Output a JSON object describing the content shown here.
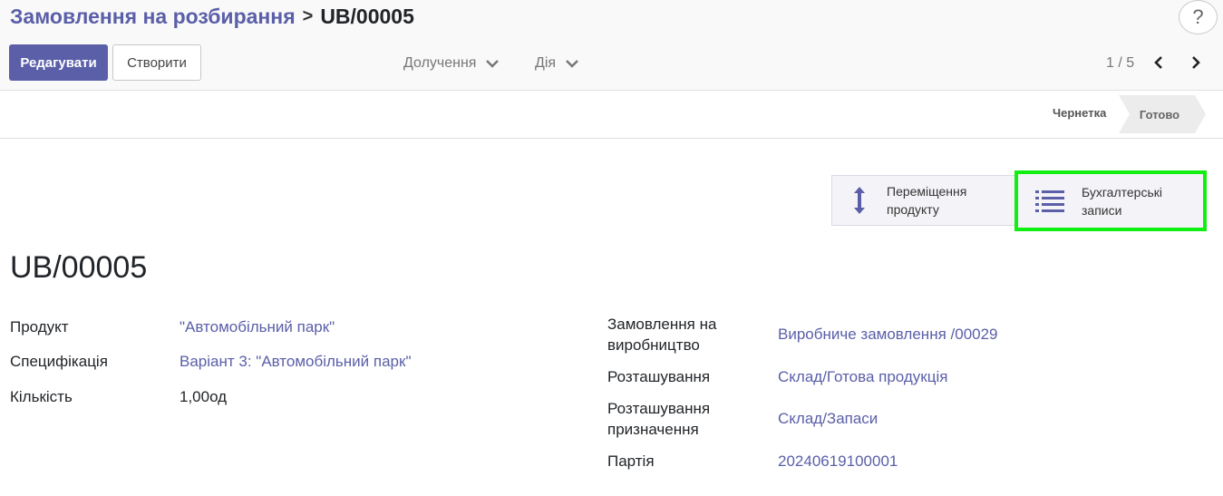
{
  "breadcrumb": {
    "parent": "Замовлення на розбирання",
    "separator": ">",
    "current": "UB/00005"
  },
  "help": {
    "label": "?"
  },
  "toolbar": {
    "edit_label": "Редагувати",
    "create_label": "Створити",
    "attach_label": "Долучення",
    "action_label": "Дія"
  },
  "pager": {
    "value": "1 / 5"
  },
  "statusbar": {
    "stages": [
      "Чернетка",
      "Готово"
    ],
    "current": "Готово"
  },
  "smart_buttons": {
    "moves": {
      "line1": "Переміщення",
      "line2": "продукту",
      "icon": "vertical-arrows-icon"
    },
    "accounting": {
      "line1": "Бухгалтерські",
      "line2": "записи",
      "icon": "list-icon"
    }
  },
  "record": {
    "title": "UB/00005",
    "left_fields": [
      {
        "label": "Продукт",
        "value": "\"Автомобільний парк\""
      },
      {
        "label": "Специфікація",
        "value": "Варіант 3: \"Автомобільний парк\""
      },
      {
        "label": "Кількість",
        "value": "1,00од"
      }
    ],
    "right_fields": [
      {
        "label_line1": "Замовлення на",
        "label_line2": "виробництво",
        "value": "Виробниче замовлення /00029"
      },
      {
        "label": "Розташування",
        "value": "Склад/Готова продукція"
      },
      {
        "label_line1": "Розташування",
        "label_line2": "призначення",
        "value": "Склад/Запаси"
      },
      {
        "label": "Партія",
        "value": "20240619100001"
      }
    ]
  },
  "colors": {
    "accent": "#5a5fa8",
    "highlight": "#11ee11"
  }
}
